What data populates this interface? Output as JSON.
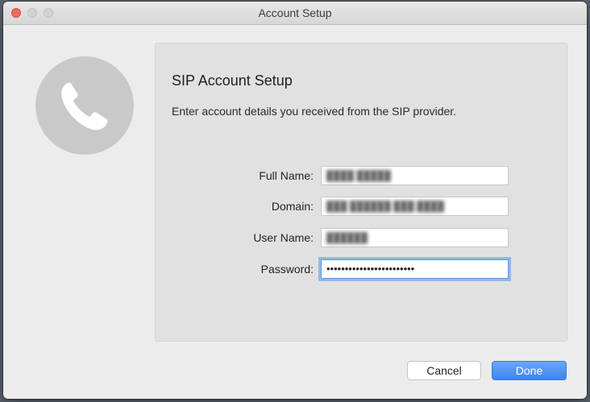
{
  "window": {
    "title": "Account Setup"
  },
  "icon": {
    "name": "phone-icon"
  },
  "form": {
    "heading": "SIP Account Setup",
    "description": "Enter account details you received from the SIP provider.",
    "fields": [
      {
        "label": "Full Name:",
        "value": "████ █████"
      },
      {
        "label": "Domain:",
        "value": "███ ██████ ███ ████"
      },
      {
        "label": "User Name:",
        "value": "██████"
      },
      {
        "label": "Password:",
        "value": "••••••••••••••••••••••••"
      }
    ]
  },
  "buttons": {
    "cancel": "Cancel",
    "done": "Done"
  },
  "colors": {
    "primary_button": "#3d84ee",
    "close_button": "#ed6a5e",
    "focus_ring": "#5b9ae9"
  }
}
